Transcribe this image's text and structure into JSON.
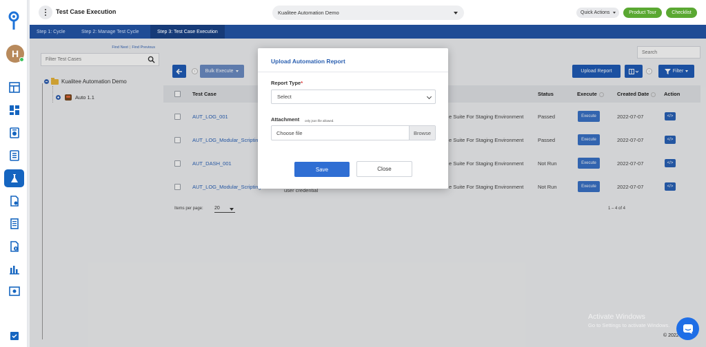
{
  "app": {
    "page_title": "Test Case Execution",
    "project": "Kualitee Automation Demo",
    "user_initial": "H",
    "quick_actions": "Quick Actions",
    "product_tour": "Product Tour",
    "checklist": "Checklist"
  },
  "sidebar": {
    "items": [
      {
        "name": "dashboard-icon"
      },
      {
        "name": "widgets-icon"
      },
      {
        "name": "requirements-icon"
      },
      {
        "name": "test-plan-icon"
      },
      {
        "name": "test-lab-icon",
        "active": true
      },
      {
        "name": "test-case-icon"
      },
      {
        "name": "cycles-icon"
      },
      {
        "name": "defects-icon"
      },
      {
        "name": "reports-icon"
      },
      {
        "name": "settings-icon"
      }
    ],
    "bottom_icon": "checklist-icon"
  },
  "steps": [
    {
      "label": "Step 1: Cycle"
    },
    {
      "label": "Step 2: Manage Test Cycle"
    },
    {
      "label": "Step 3: Test Case Execution",
      "active": true
    }
  ],
  "tree": {
    "find_next": "Find Next",
    "find_previous": "Find Previous",
    "filter_placeholder": "Filter Test Cases",
    "root": "Kualitee Automation Demo",
    "child": "Auto 1.1"
  },
  "toolbar": {
    "bulk_execute": "Bulk Execute",
    "upload_report": "Upload Report",
    "filter": "Filter",
    "search_placeholder": "Search"
  },
  "table": {
    "headers": {
      "test_case": "Test Case",
      "status": "Status",
      "execute": "Execute",
      "created_date": "Created Date",
      "action": "Action"
    },
    "rows": [
      {
        "test_case": "AUT_LOG_001",
        "suite": "e Suite For Staging Environment",
        "extra": "",
        "status": "Passed",
        "execute": "Execute",
        "date": "2022-07-07",
        "action": "</>"
      },
      {
        "test_case": "AUT_LOG_Modular_Scripting",
        "suite": "e Suite For Staging Environment",
        "extra": "",
        "status": "Passed",
        "execute": "Execute",
        "date": "2022-07-07",
        "action": "</>"
      },
      {
        "test_case": "AUT_DASH_001",
        "suite": "e Suite For Staging Environment",
        "extra": "",
        "status": "Not Run",
        "execute": "Execute",
        "date": "2022-07-07",
        "action": "</>"
      },
      {
        "test_case": "AUT_LOG_Modular_Scripting",
        "suite": "e Suite For Staging Environment",
        "extra": "user credential",
        "status": "Not Run",
        "execute": "Execute",
        "date": "2022-07-07",
        "action": "</>"
      }
    ],
    "items_per_page_label": "Items per page:",
    "items_per_page": "20",
    "range": "1 – 4 of 4"
  },
  "modal": {
    "title": "Upload Automation Report",
    "report_type_label": "Report Type",
    "required_mark": "*",
    "report_type_value": "Select",
    "attachment_label": "Attachment",
    "attachment_hint": "only json file allowed.",
    "file_placeholder": "Choose file",
    "browse": "Browse",
    "save": "Save",
    "close": "Close"
  },
  "footer": {
    "watermark_line1": "Activate Windows",
    "watermark_line2": "Go to Settings to activate Windows.",
    "copyright": "© 2022"
  },
  "colors": {
    "brand_blue": "#1f4c95",
    "primary": "#2f6ed3",
    "green": "#5aa832"
  }
}
